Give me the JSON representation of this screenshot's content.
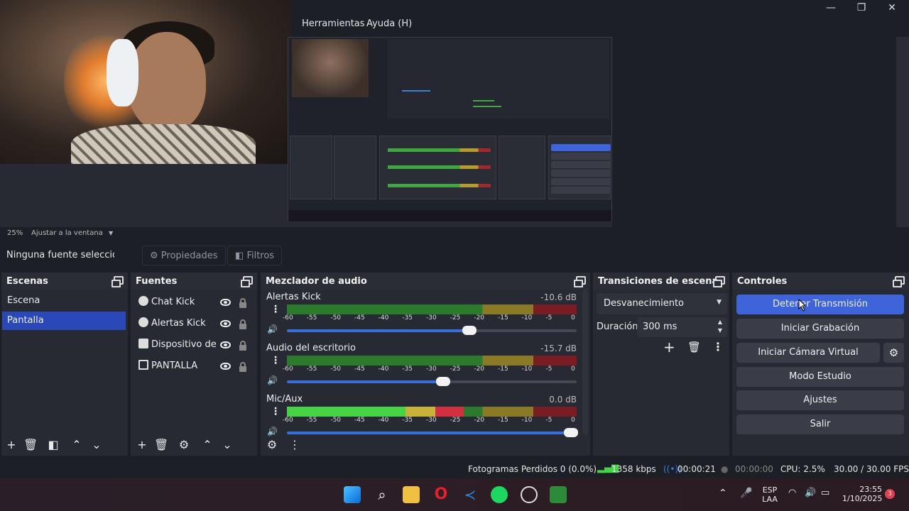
{
  "menu": {
    "tools": "Herramientas",
    "help": "Ayuda (H)"
  },
  "window_controls": {
    "minimize": "—",
    "maximize": "❐",
    "close": "✕"
  },
  "zoom": {
    "level": "25%",
    "fit": "Ajustar a la ventana"
  },
  "source_toolbar": {
    "no_source": "Ninguna fuente seleccionad",
    "properties": "Propiedades",
    "filters": "Filtros"
  },
  "scenes": {
    "title": "Escenas",
    "items": [
      "Escena",
      "Pantalla"
    ],
    "selected": "Pantalla"
  },
  "sources": {
    "title": "Fuentes",
    "items": [
      "Chat Kick",
      "Alertas Kick",
      "Dispositivo de captura",
      "PANTALLA"
    ]
  },
  "mixer": {
    "title": "Mezclador de audio",
    "ticks": [
      "-60",
      "-55",
      "-50",
      "-45",
      "-40",
      "-35",
      "-30",
      "-25",
      "-20",
      "-15",
      "-10",
      "-5",
      "0"
    ],
    "channels": [
      {
        "name": "Alertas Kick",
        "db": "-10.6 dB",
        "level": 0,
        "volume": 0.63
      },
      {
        "name": "Audio del escritorio",
        "db": "-15.7 dB",
        "level": 0,
        "volume": 0.54
      },
      {
        "name": "Mic/Aux",
        "db": "0.0 dB",
        "level": 0.61,
        "volume": 0.98
      }
    ]
  },
  "transitions": {
    "title": "Transiciones de escena",
    "type": "Desvanecimiento",
    "duration_label": "Duración",
    "duration": "300 ms"
  },
  "controls": {
    "title": "Controles",
    "stop_stream": "Detener Transmisión",
    "start_recording": "Iniciar Grabación",
    "virtual_cam": "Iniciar Cámara Virtual",
    "studio_mode": "Modo Estudio",
    "settings": "Ajustes",
    "exit": "Salir"
  },
  "status": {
    "dropped": "Fotogramas Perdidos 0 (0.0%)",
    "bitrate": "1358 kbps",
    "stream_time": "00:00:21",
    "rec_time": "00:00:00",
    "cpu": "CPU: 2.5%",
    "fps": "30.00 / 30.00 FPS"
  },
  "taskbar": {
    "lang": "ESP",
    "region": "LAA",
    "time": "23:55",
    "date": "1/10/2025",
    "notif_count": "3"
  },
  "colors": {
    "accent": "#3f63d9",
    "selected": "#2b48b8",
    "panel": "#272a33",
    "bg": "#1d1f26"
  }
}
